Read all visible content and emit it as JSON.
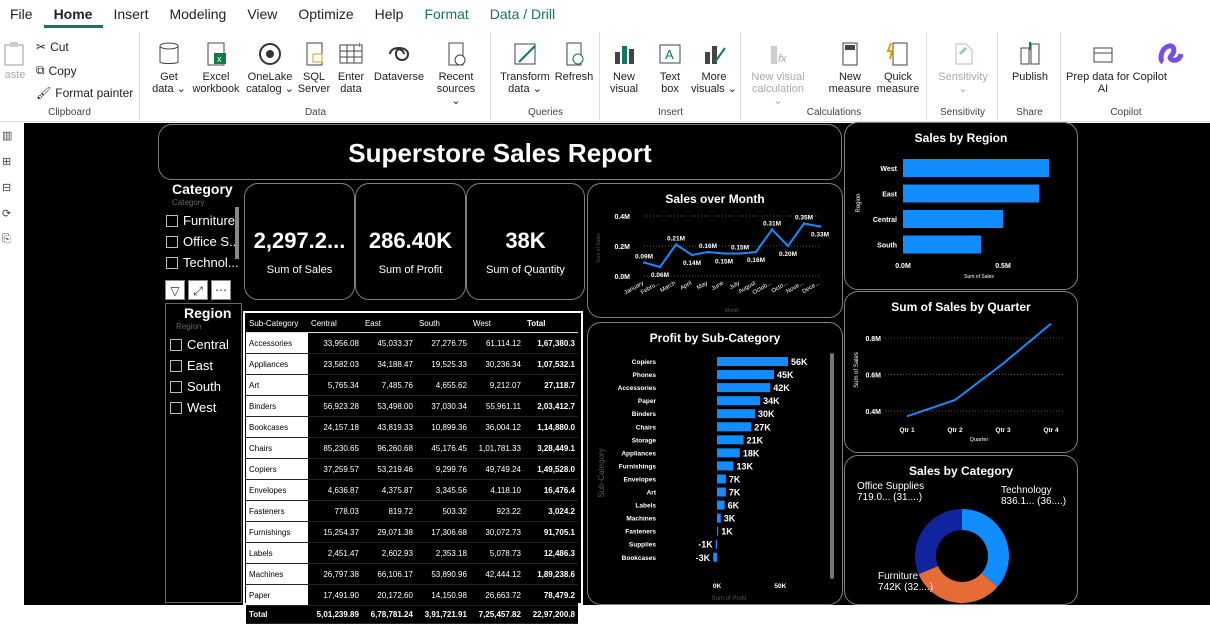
{
  "menu": {
    "file": "File",
    "home": "Home",
    "insert": "Insert",
    "modeling": "Modeling",
    "view": "View",
    "optimize": "Optimize",
    "help": "Help",
    "format": "Format",
    "data_drill": "Data / Drill"
  },
  "ribbon": {
    "clipboard": {
      "paste": "aste",
      "cut": "Cut",
      "copy": "Copy",
      "format_painter": "Format painter",
      "group": "Clipboard"
    },
    "data": {
      "get_data": "Get",
      "get_data2": "data ⌄",
      "excel": "Excel",
      "excel2": "workbook",
      "onelake": "OneLake",
      "onelake2": "catalog ⌄",
      "sql": "SQL",
      "sql2": "Server",
      "enter": "Enter",
      "enter2": "data",
      "dataverse": "Dataverse",
      "recent": "Recent",
      "recent2": "sources ⌄",
      "group": "Data"
    },
    "queries": {
      "transform": "Transform",
      "transform2": "data ⌄",
      "refresh": "Refresh",
      "group": "Queries"
    },
    "insert": {
      "new_visual": "New",
      "new_visual2": "visual",
      "text_box": "Text",
      "text_box2": "box",
      "more": "More",
      "more2": "visuals ⌄",
      "group": "Insert"
    },
    "calculations": {
      "new_visual_calc": "New visual",
      "new_visual_calc2": "calculation ⌄",
      "new_measure": "New",
      "new_measure2": "measure",
      "quick_measure": "Quick",
      "quick_measure2": "measure",
      "group": "Calculations"
    },
    "sensitivity": {
      "label": "Sensitivity",
      "label2": "⌄",
      "group": "Sensitivity"
    },
    "share": {
      "publish": "Publish",
      "group": "Share"
    },
    "copilot": {
      "prep": "Prep data for Copilot",
      "prep2": "AI",
      "group": "Copilot"
    }
  },
  "report": {
    "title": "Superstore Sales Report",
    "category_slicer": {
      "header": "Category",
      "placeholder": "Category",
      "items": [
        "Furniture",
        "Office S...",
        "Technol..."
      ]
    },
    "region_slicer": {
      "header": "Region",
      "placeholder": "Region",
      "items": [
        "Central",
        "East",
        "South",
        "West"
      ]
    },
    "kpis": [
      {
        "value": "2,297.2...",
        "label": "Sum of Sales"
      },
      {
        "value": "286.40K",
        "label": "Sum of Profit"
      },
      {
        "value": "38K",
        "label": "Sum of Quantity"
      }
    ],
    "matrix": {
      "headers": [
        "Sub-Category",
        "Central",
        "East",
        "South",
        "West",
        "Total"
      ],
      "rows": [
        [
          "Accessories",
          "33,956.08",
          "45,033.37",
          "27,276.75",
          "61,114.12",
          "1,67,380.3"
        ],
        [
          "Appliances",
          "23,582.03",
          "34,188.47",
          "19,525.33",
          "30,236.34",
          "1,07,532.1"
        ],
        [
          "Art",
          "5,765.34",
          "7,485.76",
          "4,655.62",
          "9,212.07",
          "27,118.7"
        ],
        [
          "Binders",
          "56,923.28",
          "53,498.00",
          "37,030.34",
          "55,961.11",
          "2,03,412.7"
        ],
        [
          "Bookcases",
          "24,157.18",
          "43,819.33",
          "10,899.36",
          "36,004.12",
          "1,14,880.0"
        ],
        [
          "Chairs",
          "85,230.65",
          "96,260.68",
          "45,176.45",
          "1,01,781.33",
          "3,28,449.1"
        ],
        [
          "Copiers",
          "37,259.57",
          "53,219.46",
          "9,299.76",
          "49,749.24",
          "1,49,528.0"
        ],
        [
          "Envelopes",
          "4,636.87",
          "4,375.87",
          "3,345.56",
          "4,118.10",
          "16,476.4"
        ],
        [
          "Fasteners",
          "778.03",
          "819.72",
          "503.32",
          "923.22",
          "3,024.2"
        ],
        [
          "Furnishings",
          "15,254.37",
          "29,071.38",
          "17,306.68",
          "30,072.73",
          "91,705.1"
        ],
        [
          "Labels",
          "2,451.47",
          "2,602.93",
          "2,353.18",
          "5,078.73",
          "12,486.3"
        ],
        [
          "Machines",
          "26,797.38",
          "66,106.17",
          "53,890.96",
          "42,444.12",
          "1,89,238.6"
        ],
        [
          "Paper",
          "17,491.90",
          "20,172.60",
          "14,150.98",
          "26,663.72",
          "78,479.2"
        ]
      ],
      "total": [
        "Total",
        "5,01,239.89",
        "6,78,781.24",
        "3,91,721.91",
        "7,25,457.82",
        "22,97,200.8"
      ]
    }
  },
  "colors": {
    "accent": "#118DFF",
    "orange": "#E66C37",
    "navy": "#12239E",
    "brand_green": "#117865"
  },
  "chart_data": [
    {
      "type": "line",
      "title": "Sales over Month",
      "xlabel": "Month",
      "ylabel": "Sum of Sales",
      "x": [
        "January",
        "February",
        "March",
        "April",
        "May",
        "June",
        "July",
        "August",
        "September",
        "October",
        "November",
        "December"
      ],
      "x_ticks": [
        "January",
        "Febru...",
        "March",
        "April",
        "May",
        "June",
        "July",
        "August",
        "Octob...",
        "Octo...",
        "Nove...",
        "Dece..."
      ],
      "series": [
        {
          "values": [
            0.09,
            0.06,
            0.21,
            0.14,
            0.16,
            0.15,
            0.15,
            0.16,
            0.31,
            0.2,
            0.35,
            0.33
          ]
        }
      ],
      "data_labels": [
        "0.09M",
        "0.06M",
        "0.21M",
        "0.14M",
        "0.16M",
        "0.15M",
        "0.15M",
        "0.16M",
        "0.31M",
        "0.20M",
        "0.35M",
        "0.33M"
      ],
      "y_ticks": [
        "0.0M",
        "0.2M",
        "0.4M"
      ],
      "ylim": [
        0,
        0.4
      ],
      "grid": true
    },
    {
      "type": "bar",
      "title": "Sales by Region",
      "xlabel": "Sum of Sales",
      "ylabel": "Region",
      "categories": [
        "West",
        "East",
        "Central",
        "South"
      ],
      "values": [
        0.73,
        0.68,
        0.5,
        0.39
      ],
      "x_ticks": [
        "0.0M",
        "0.5M"
      ],
      "xlim": [
        0,
        0.8
      ]
    },
    {
      "type": "line",
      "title": "Sum of Sales by Quarter",
      "xlabel": "Quarter",
      "ylabel": "Sum of Sales",
      "x": [
        "Qtr 1",
        "Qtr 2",
        "Qtr 3",
        "Qtr 4"
      ],
      "series": [
        {
          "values": [
            0.37,
            0.46,
            0.66,
            0.88
          ]
        }
      ],
      "y_ticks": [
        "0.4M",
        "0.6M",
        "0.8M"
      ],
      "ylim": [
        0.35,
        0.9
      ]
    },
    {
      "type": "bar",
      "title": "Profit by Sub-Category",
      "xlabel": "Sum of Profit",
      "ylabel": "Sub-Category",
      "categories": [
        "Copiers",
        "Phones",
        "Accessories",
        "Paper",
        "Binders",
        "Chairs",
        "Storage",
        "Appliances",
        "Furnishings",
        "Envelopes",
        "Art",
        "Labels",
        "Machines",
        "Fasteners",
        "Supplies",
        "Bookcases"
      ],
      "values": [
        56,
        45,
        42,
        34,
        30,
        27,
        21,
        18,
        13,
        7,
        7,
        6,
        3,
        1,
        -1,
        -3
      ],
      "data_labels": [
        "56K",
        "45K",
        "42K",
        "34K",
        "30K",
        "27K",
        "21K",
        "18K",
        "13K",
        "7K",
        "7K",
        "6K",
        "3K",
        "1K",
        "-1K",
        "-3K"
      ],
      "x_ticks": [
        "0K",
        "50K"
      ]
    },
    {
      "type": "pie",
      "title": "Sales by Category",
      "labels": [
        "Technology",
        "Furniture",
        "Office Supplies"
      ],
      "values": [
        836.1,
        742,
        719.0
      ],
      "slice_labels": [
        "Technology",
        "Furniture",
        "Office Supplies"
      ],
      "slice_values": [
        "836.1... (36....)",
        "742K (32....)",
        "719.0... (31....)"
      ]
    }
  ]
}
